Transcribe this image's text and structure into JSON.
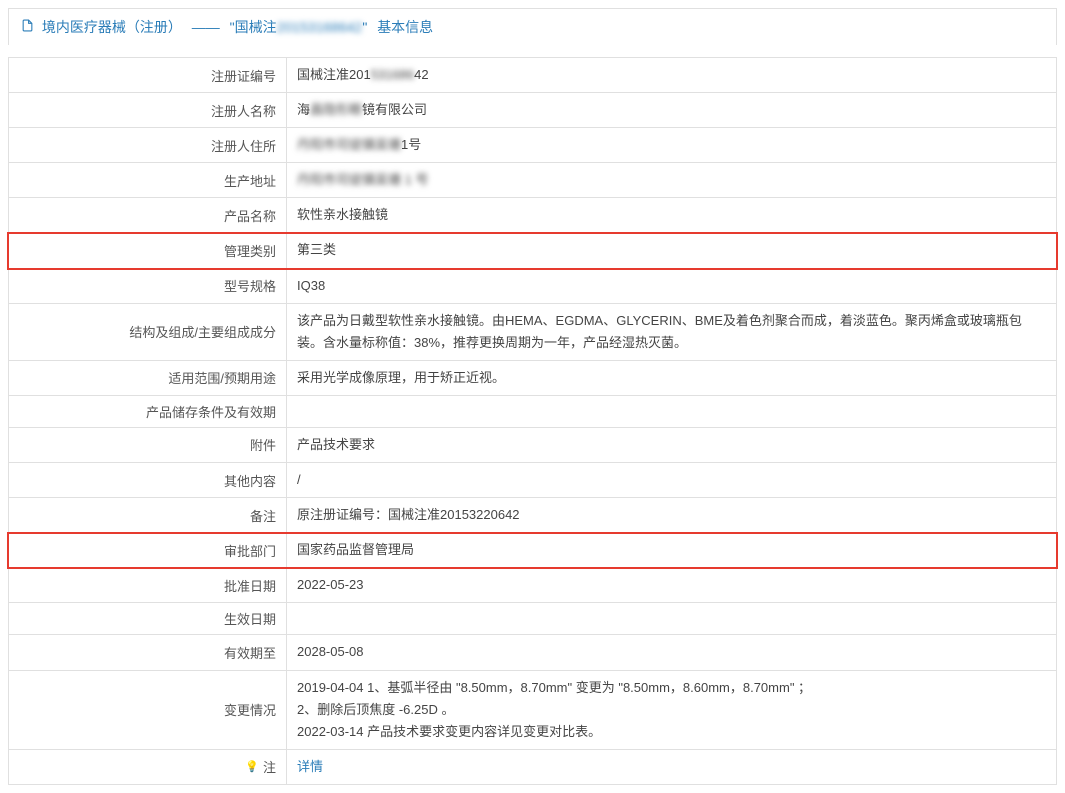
{
  "header": {
    "category": "境内医疗器械（注册）",
    "separator": "——",
    "quoted_prefix": "\"国械注",
    "obscured": "20153168642",
    "quoted_suffix": "\"",
    "tail": "基本信息"
  },
  "rows": [
    {
      "label": "注册证编号",
      "prefix": "国械注准201",
      "obscured": "531686",
      "suffix": "42",
      "highlighted": false
    },
    {
      "label": "注册人名称",
      "prefix": "海",
      "obscured": "昌隐形眼",
      "suffix": "镜有限公司",
      "highlighted": false
    },
    {
      "label": "注册人住所",
      "prefix": "",
      "obscured": "丹阳市司徒镇吴塘",
      "suffix": "1号",
      "highlighted": false
    },
    {
      "label": "生产地址",
      "prefix": "",
      "obscured": "丹阳市司徒镇吴塘 1 号",
      "suffix": "",
      "highlighted": false
    },
    {
      "label": "产品名称",
      "value": "软性亲水接触镜",
      "highlighted": false
    },
    {
      "label": "管理类别",
      "value": "第三类",
      "highlighted": true
    },
    {
      "label": "型号规格",
      "value": "IQ38",
      "highlighted": false
    },
    {
      "label": "结构及组成/主要组成成分",
      "value": "该产品为日戴型软性亲水接触镜。由HEMA、EGDMA、GLYCERIN、BME及着色剂聚合而成，着淡蓝色。聚丙烯盒或玻璃瓶包装。含水量标称值：38%，推荐更换周期为一年，产品经湿热灭菌。",
      "highlighted": false
    },
    {
      "label": "适用范围/预期用途",
      "value": "采用光学成像原理，用于矫正近视。",
      "highlighted": false
    },
    {
      "label": "产品储存条件及有效期",
      "value": "",
      "highlighted": false
    },
    {
      "label": "附件",
      "value": "产品技术要求",
      "highlighted": false
    },
    {
      "label": "其他内容",
      "value": "/",
      "highlighted": false
    },
    {
      "label": "备注",
      "value": "原注册证编号：国械注准20153220642",
      "highlighted": false
    },
    {
      "label": "审批部门",
      "value": "国家药品监督管理局",
      "highlighted": true
    },
    {
      "label": "批准日期",
      "value": "2022-05-23",
      "highlighted": false
    },
    {
      "label": "生效日期",
      "value": "",
      "highlighted": false
    },
    {
      "label": "有效期至",
      "value": "2028-05-08",
      "highlighted": false
    },
    {
      "label": "变更情况",
      "value": "2019-04-04 1、基弧半径由 \"8.50mm，8.70mm\" 变更为 \"8.50mm，8.60mm，8.70mm\" ；\n2、删除后顶焦度 -6.25D 。\n2022-03-14 产品技术要求变更内容详见变更对比表。",
      "highlighted": false,
      "multiline": true
    }
  ],
  "footer": {
    "note_icon": "💡",
    "note_label": "注",
    "detail_link": "详情"
  }
}
